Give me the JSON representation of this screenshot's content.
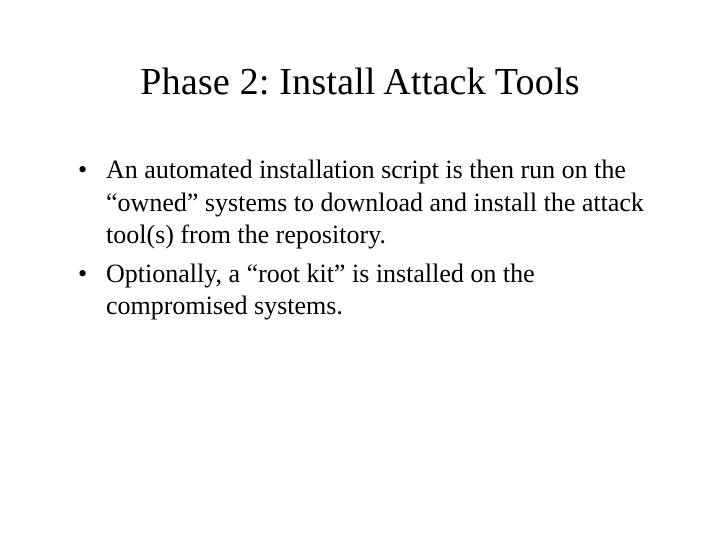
{
  "slide": {
    "title": "Phase 2: Install Attack Tools",
    "bullets": [
      "An automated installation script is then run on the “owned” systems to download and install the attack tool(s) from the repository.",
      "Optionally, a “root kit” is installed on the compromised systems."
    ]
  }
}
